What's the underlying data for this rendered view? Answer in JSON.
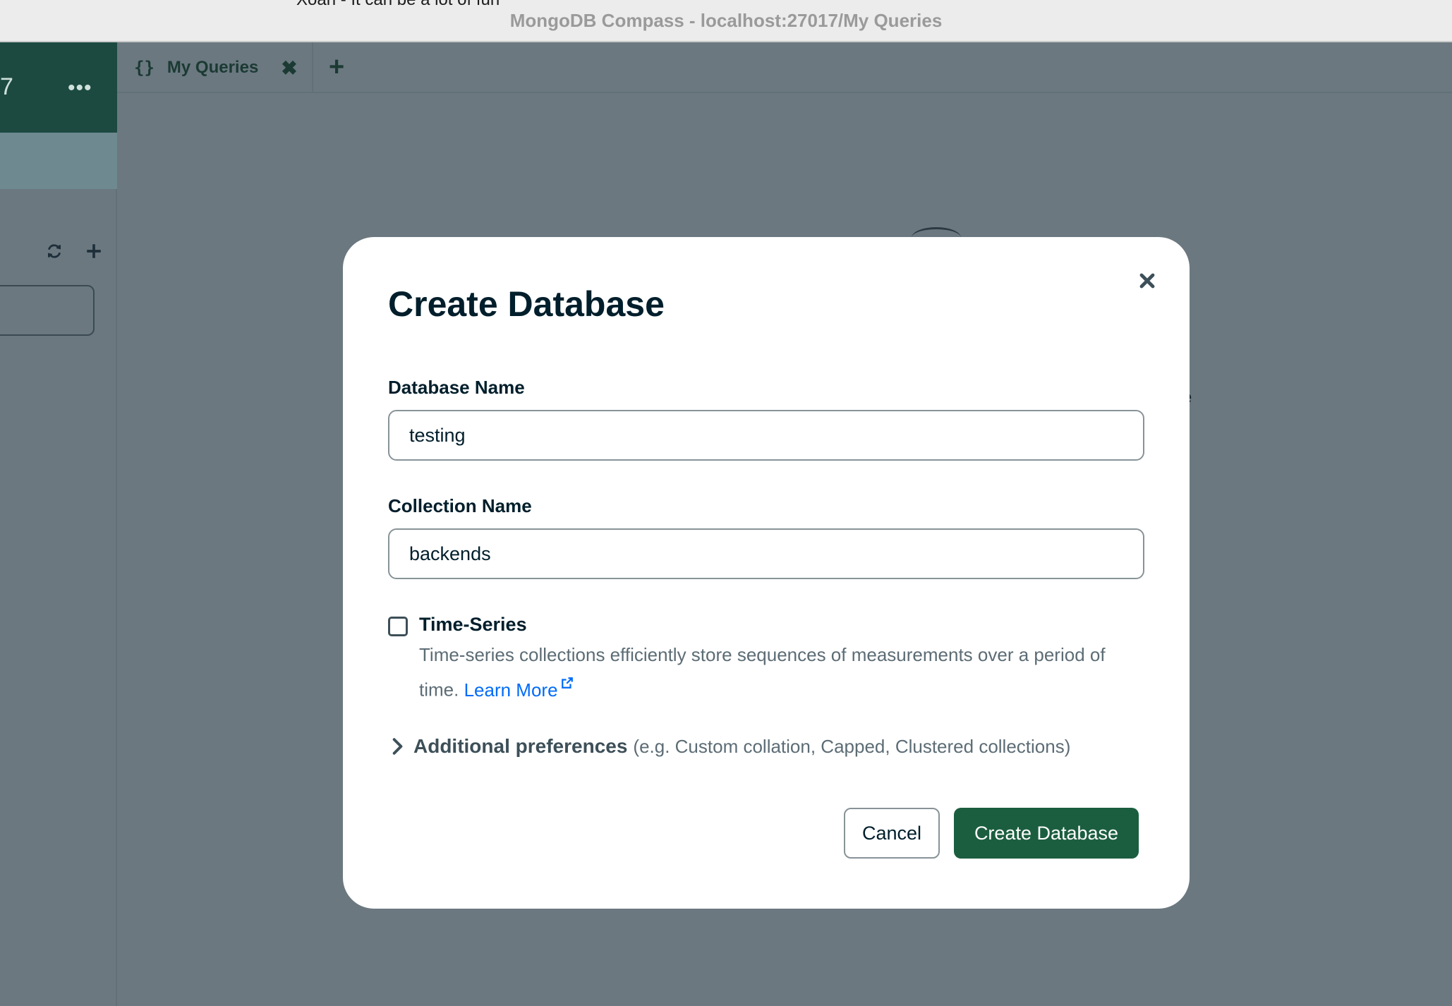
{
  "window": {
    "title": "MongoDB Compass - localhost:27017/My Queries",
    "background_text": "Xoan - It can be a lot of fun"
  },
  "sidebar": {
    "connection_suffix": "7",
    "more_label": "•••",
    "refresh_icon": "refresh-icon",
    "add_icon": "plus-icon"
  },
  "tabs": [
    {
      "icon": "{}",
      "label": "My Queries",
      "close": "✖"
    }
  ],
  "new_tab_label": "+",
  "background_fragment": "e",
  "modal": {
    "title": "Create Database",
    "database_name_label": "Database Name",
    "database_name_value": "testing",
    "collection_name_label": "Collection Name",
    "collection_name_value": "backends",
    "time_series_label": "Time-Series",
    "time_series_checked": false,
    "time_series_description": "Time-series collections efficiently store sequences of measurements over a period of time.",
    "learn_more": "Learn More",
    "additional_preferences_label": "Additional preferences",
    "additional_preferences_hint": "(e.g. Custom collation, Capped, Clustered collections)",
    "cancel_label": "Cancel",
    "create_label": "Create Database"
  },
  "colors": {
    "primary_button": "#1b5e3f",
    "link": "#016bf8",
    "overlay": "#6b7880",
    "header_dark": "#1c4a41"
  }
}
